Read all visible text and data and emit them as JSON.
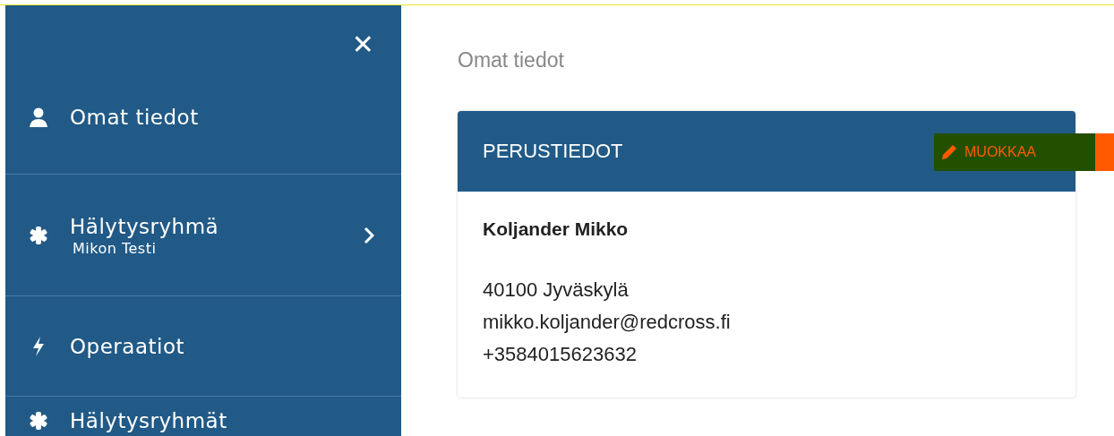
{
  "sidebar": {
    "close": "✕",
    "items": [
      {
        "kind": "person",
        "label": "Omat tiedot",
        "has_arrow": false
      },
      {
        "kind": "asterisk",
        "label": "Hälytysryhmä",
        "sublabel": "Mikon Testi",
        "has_arrow": true
      },
      {
        "kind": "bolt",
        "label": "Operaatiot",
        "has_arrow": false
      },
      {
        "kind": "asterisk",
        "label": "Hälytysryhmät",
        "has_arrow": false
      }
    ]
  },
  "breadcrumb": "Omat tiedot",
  "card": {
    "title": "PERUSTIEDOT",
    "edit_button": "MUOKKAA",
    "name": "Koljander Mikko",
    "lines": [
      "40100 Jyväskylä",
      "mikko.koljander@redcross.fi",
      "+3584015623632"
    ]
  }
}
